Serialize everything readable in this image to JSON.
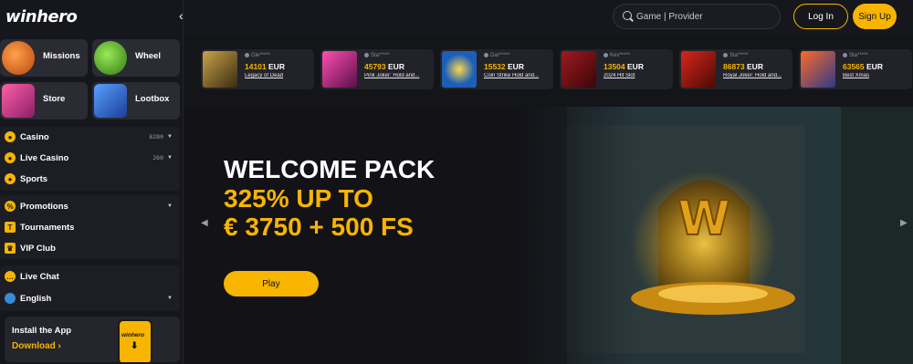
{
  "brand": {
    "logo_text": "winhero"
  },
  "tiles": [
    {
      "label": "Missions",
      "color": "#e8742a"
    },
    {
      "label": "Wheel",
      "color": "#5fbf2a"
    },
    {
      "label": "Store",
      "color": "#d9377a"
    },
    {
      "label": "Lootbox",
      "color": "#2b6fd6"
    }
  ],
  "nav": {
    "casino": {
      "label": "Casino",
      "count": "8280"
    },
    "live_casino": {
      "label": "Live Casino",
      "count": "260"
    },
    "sports": {
      "label": "Sports"
    },
    "promotions": {
      "label": "Promotions"
    },
    "tournaments": {
      "label": "Tournaments"
    },
    "vip": {
      "label": "VIP Club"
    },
    "live_chat": {
      "label": "Live Chat"
    },
    "language": {
      "label": "English"
    }
  },
  "app_promo": {
    "title": "Install the App",
    "cta": "Download ›",
    "phone_label": "winhero"
  },
  "header": {
    "search_placeholder": "Game | Provider",
    "login": "Log In",
    "signup": "Sign Up"
  },
  "recent_wins": [
    {
      "user": "Gle*****",
      "amount": "14101",
      "currency": "EUR",
      "game": "Legacy of Dead",
      "color": "#6a5420"
    },
    {
      "user": "Sta*****",
      "amount": "45793",
      "currency": "EUR",
      "game": "Pink Joker: Hold and...",
      "color": "#a0206e"
    },
    {
      "user": "Dar*****",
      "amount": "15532",
      "currency": "EUR",
      "game": "Coin Strike Hold and...",
      "color": "#1d5fb8"
    },
    {
      "user": "Kev*****",
      "amount": "13504",
      "currency": "EUR",
      "game": "2024 Hit Slot",
      "color": "#7a1016"
    },
    {
      "user": "Sta*****",
      "amount": "86873",
      "currency": "EUR",
      "game": "Royal Joker: Hold and...",
      "color": "#8a1a10"
    },
    {
      "user": "Sta*****",
      "amount": "63565",
      "currency": "EUR",
      "game": "Best Xmas",
      "color": "#2a3a8a"
    }
  ],
  "hero": {
    "line1": "WELCOME PACK",
    "line2": "325% UP TO",
    "line3": "€ 3750 + 500 FS",
    "button": "Play",
    "emblem": "W"
  },
  "colors": {
    "accent": "#f7b500",
    "bg": "#16171d",
    "panel": "#1d1e25"
  }
}
